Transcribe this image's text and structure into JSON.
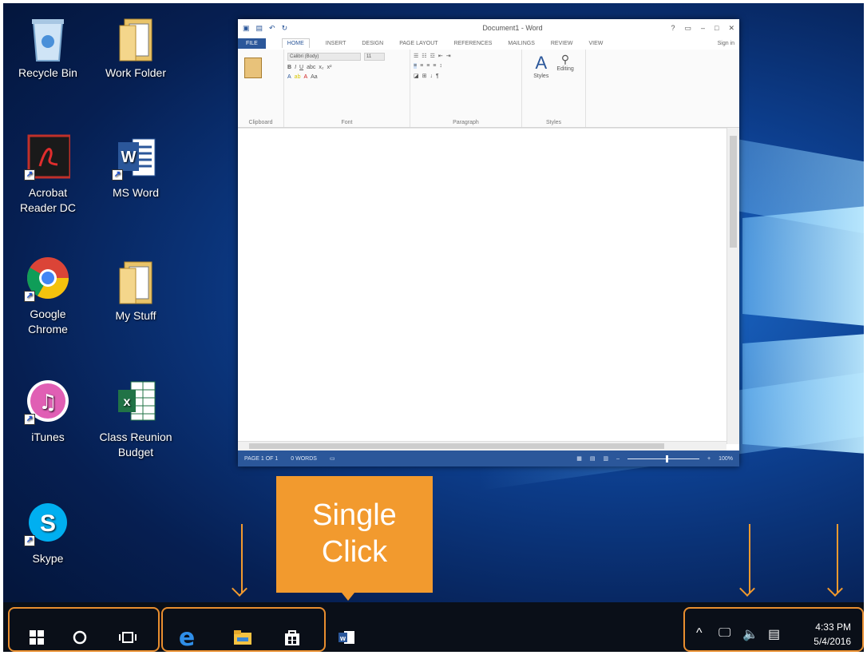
{
  "desktop": {
    "icons": [
      {
        "label": "Recycle Bin",
        "icon": "recycle-bin-icon"
      },
      {
        "label": "Work Folder",
        "icon": "folder-icon"
      },
      {
        "label": "Acrobat Reader DC",
        "icon": "acrobat-icon"
      },
      {
        "label": "MS Word",
        "icon": "word-icon"
      },
      {
        "label": "Google Chrome",
        "icon": "chrome-icon"
      },
      {
        "label": "My Stuff",
        "icon": "folder-icon"
      },
      {
        "label": "iTunes",
        "icon": "itunes-icon"
      },
      {
        "label": "Class Reunion Budget",
        "icon": "excel-icon"
      },
      {
        "label": "Skype",
        "icon": "skype-icon"
      }
    ]
  },
  "word": {
    "title": "Document1 - Word",
    "tabs": [
      "FILE",
      "HOME",
      "INSERT",
      "DESIGN",
      "PAGE LAYOUT",
      "REFERENCES",
      "MAILINGS",
      "REVIEW",
      "VIEW"
    ],
    "sign_in": "Sign in",
    "groups": {
      "clipboard": "Clipboard",
      "font": "Font",
      "paragraph": "Paragraph",
      "styles": "Styles"
    },
    "font_name": "Calibri (Body)",
    "font_size": "11",
    "styles_label": "Styles",
    "editing_label": "Editing",
    "status": {
      "page": "PAGE 1 OF 1",
      "words": "0 WORDS",
      "zoom": "100%"
    }
  },
  "callout": {
    "line1": "Single",
    "line2": "Click"
  },
  "taskbar": {
    "clock_time": "4:33 PM",
    "clock_date": "5/4/2016"
  },
  "colors": {
    "accent": "#f29a2e",
    "word_blue": "#2b579a",
    "taskbar": "#0a0f18"
  }
}
